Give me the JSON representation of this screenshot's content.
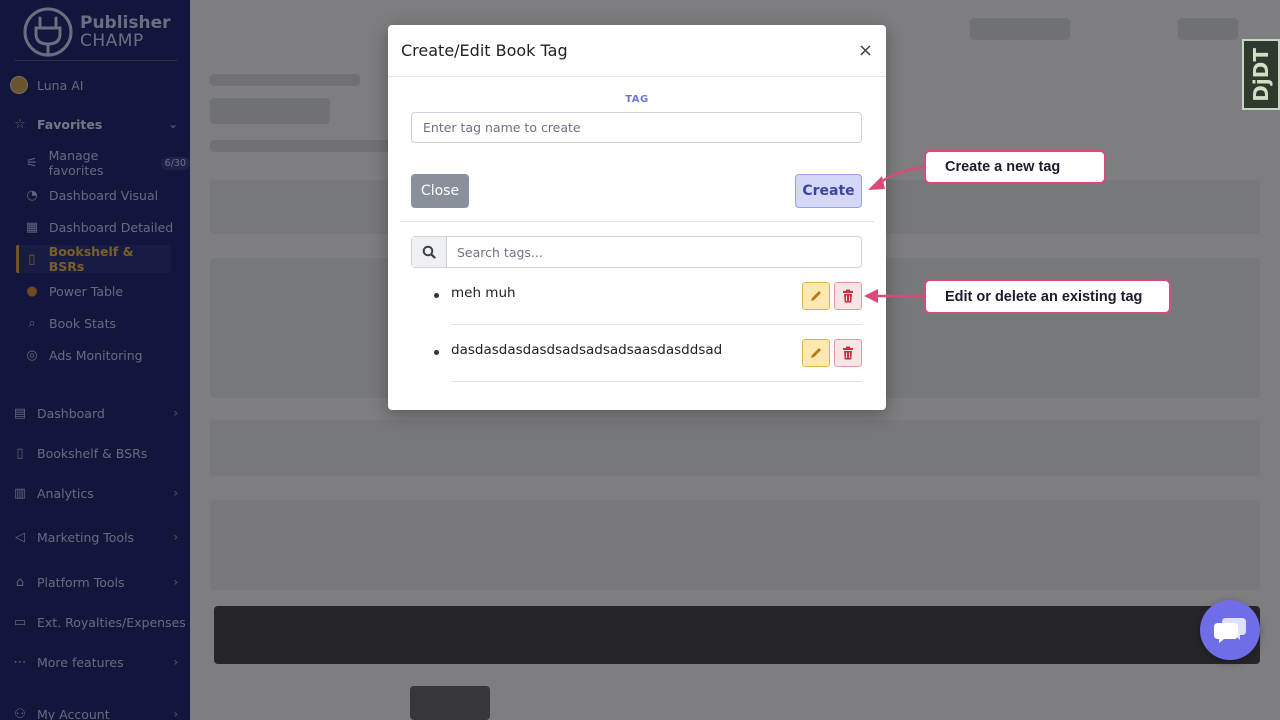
{
  "sidebar": {
    "logo_line1": "Publisher",
    "logo_line2": "CHAMP",
    "user_name": "Luna AI",
    "favorites_label": "Favorites",
    "favorites": [
      {
        "label": "Manage favorites",
        "badge": "6/30"
      },
      {
        "label": "Dashboard Visual"
      },
      {
        "label": "Dashboard Detailed"
      },
      {
        "label": "Bookshelf & BSRs"
      },
      {
        "label": "Power Table"
      },
      {
        "label": "Book Stats"
      },
      {
        "label": "Ads Monitoring"
      }
    ],
    "sections": [
      {
        "label": "Dashboard"
      },
      {
        "label": "Bookshelf & BSRs"
      },
      {
        "label": "Analytics"
      },
      {
        "label": "Marketing Tools"
      },
      {
        "label": "Platform Tools"
      },
      {
        "label": "Ext. Royalties/Expenses"
      },
      {
        "label": "More features"
      },
      {
        "label": "My Account"
      }
    ]
  },
  "modal": {
    "title": "Create/Edit Book Tag",
    "close_glyph": "×",
    "tag_label": "TAG",
    "tag_placeholder": "Enter tag name to create",
    "close_label": "Close",
    "create_label": "Create",
    "search_placeholder": "Search tags...",
    "tags": [
      {
        "name": "meh muh"
      },
      {
        "name": "dasdasdasdasdsadsadsadsaasdasddsad"
      }
    ]
  },
  "callouts": {
    "create": "Create a new tag",
    "edit": "Edit or delete an existing tag"
  },
  "djdt_label": "DjDT",
  "colors": {
    "sidebar_bg": "#232a73",
    "active_accent": "#e6b54e",
    "callout_border": "#d94a78",
    "chat_bg": "#6f6ee6"
  }
}
